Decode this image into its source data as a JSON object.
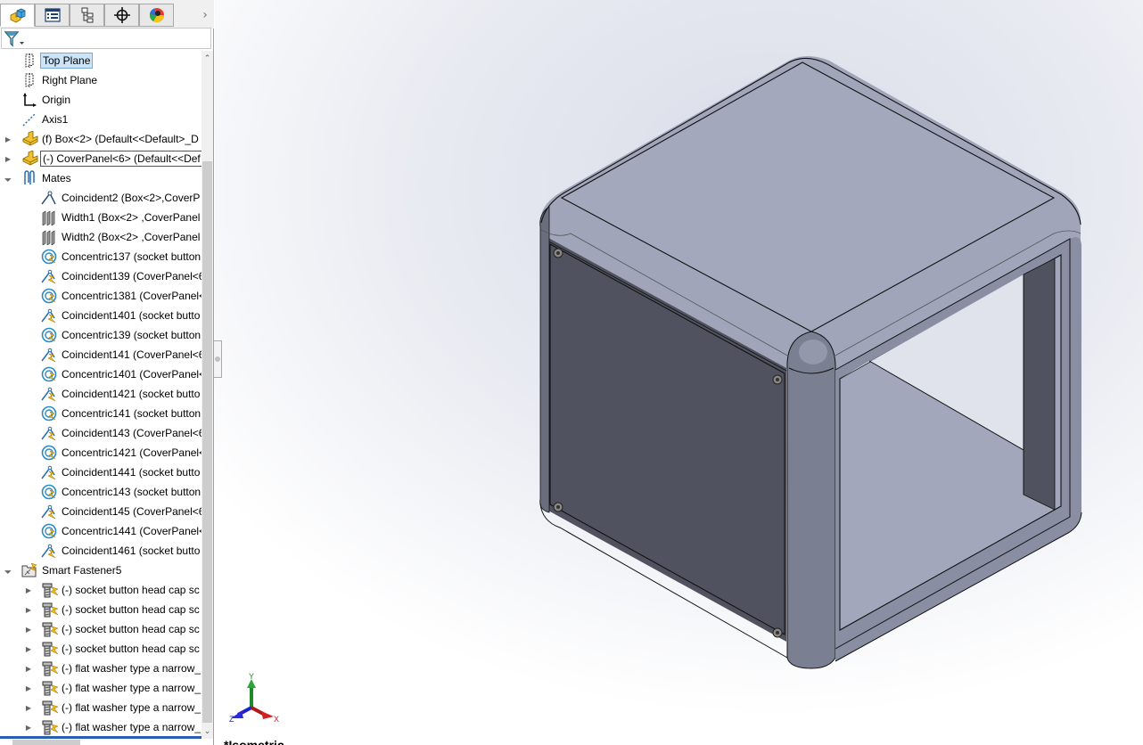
{
  "panel_tabs": [
    {
      "name": "FeatureManager Design Tree",
      "icon": "feature-manager-icon",
      "active": true
    },
    {
      "name": "PropertyManager",
      "icon": "property-manager-icon",
      "active": false
    },
    {
      "name": "ConfigurationManager",
      "icon": "configuration-manager-icon",
      "active": false
    },
    {
      "name": "DimXpertManager",
      "icon": "dimxpert-icon",
      "active": false
    },
    {
      "name": "DisplayManager",
      "icon": "display-manager-icon",
      "active": false
    }
  ],
  "tabs_more": "›",
  "filter": {
    "icon": "filter-icon",
    "dropdown": "▾"
  },
  "tree": [
    {
      "label": "Top Plane",
      "icon": "plane-icon",
      "level": 0,
      "expander": "",
      "selected": true
    },
    {
      "label": "Right Plane",
      "icon": "plane-icon",
      "level": 0,
      "expander": ""
    },
    {
      "label": "Origin",
      "icon": "origin-icon",
      "level": 0,
      "expander": ""
    },
    {
      "label": "Axis1",
      "icon": "axis-icon",
      "level": 0,
      "expander": ""
    },
    {
      "label": "(f) Box<2> (Default<<Default>_D",
      "icon": "part-icon",
      "level": 0,
      "expander": "▶"
    },
    {
      "label": "(-) CoverPanel<6> (Default<<Def",
      "icon": "part-icon",
      "level": 0,
      "expander": "▶",
      "boxed": true
    },
    {
      "label": "Mates",
      "icon": "mates-icon",
      "level": 0,
      "expander": "◢"
    },
    {
      "label": "Coincident2 (Box<2>,CoverP",
      "icon": "coincident-mate-icon",
      "level": 1,
      "expander": ""
    },
    {
      "label": "Width1 (Box<2> ,CoverPanel",
      "icon": "width-mate-icon",
      "level": 1,
      "expander": ""
    },
    {
      "label": "Width2 (Box<2> ,CoverPanel",
      "icon": "width-mate-icon",
      "level": 1,
      "expander": ""
    },
    {
      "label": "Concentric137 (socket button",
      "icon": "concentric-mate-icon",
      "level": 1,
      "expander": ""
    },
    {
      "label": "Coincident139 (CoverPanel<6",
      "icon": "coincident-fastener-mate-icon",
      "level": 1,
      "expander": ""
    },
    {
      "label": "Concentric1381 (CoverPanel<",
      "icon": "concentric-mate-icon",
      "level": 1,
      "expander": ""
    },
    {
      "label": "Coincident1401 (socket butto",
      "icon": "coincident-fastener-mate-icon",
      "level": 1,
      "expander": ""
    },
    {
      "label": "Concentric139 (socket button",
      "icon": "concentric-mate-icon",
      "level": 1,
      "expander": ""
    },
    {
      "label": "Coincident141 (CoverPanel<6",
      "icon": "coincident-fastener-mate-icon",
      "level": 1,
      "expander": ""
    },
    {
      "label": "Concentric1401 (CoverPanel<",
      "icon": "concentric-mate-icon",
      "level": 1,
      "expander": ""
    },
    {
      "label": "Coincident1421 (socket butto",
      "icon": "coincident-fastener-mate-icon",
      "level": 1,
      "expander": ""
    },
    {
      "label": "Concentric141 (socket button",
      "icon": "concentric-mate-icon",
      "level": 1,
      "expander": ""
    },
    {
      "label": "Coincident143 (CoverPanel<6",
      "icon": "coincident-fastener-mate-icon",
      "level": 1,
      "expander": ""
    },
    {
      "label": "Concentric1421 (CoverPanel<",
      "icon": "concentric-mate-icon",
      "level": 1,
      "expander": ""
    },
    {
      "label": "Coincident1441 (socket butto",
      "icon": "coincident-fastener-mate-icon",
      "level": 1,
      "expander": ""
    },
    {
      "label": "Concentric143 (socket button",
      "icon": "concentric-mate-icon",
      "level": 1,
      "expander": ""
    },
    {
      "label": "Coincident145 (CoverPanel<6",
      "icon": "coincident-fastener-mate-icon",
      "level": 1,
      "expander": ""
    },
    {
      "label": "Concentric1441 (CoverPanel<",
      "icon": "concentric-mate-icon",
      "level": 1,
      "expander": ""
    },
    {
      "label": "Coincident1461 (socket butto",
      "icon": "coincident-fastener-mate-icon",
      "level": 1,
      "expander": ""
    },
    {
      "label": "Smart Fastener5",
      "icon": "smart-fastener-folder-icon",
      "level": 0,
      "expander": "◢"
    },
    {
      "label": "(-) socket button head cap sc",
      "icon": "fastener-icon",
      "level": 1,
      "expander": "▶"
    },
    {
      "label": "(-) socket button head cap sc",
      "icon": "fastener-icon",
      "level": 1,
      "expander": "▶"
    },
    {
      "label": "(-) socket button head cap sc",
      "icon": "fastener-icon",
      "level": 1,
      "expander": "▶"
    },
    {
      "label": "(-) socket button head cap sc",
      "icon": "fastener-icon",
      "level": 1,
      "expander": "▶"
    },
    {
      "label": "(-) flat washer type a narrow_",
      "icon": "fastener-icon",
      "level": 1,
      "expander": "▶"
    },
    {
      "label": "(-) flat washer type a narrow_",
      "icon": "fastener-icon",
      "level": 1,
      "expander": "▶"
    },
    {
      "label": "(-) flat washer type a narrow_",
      "icon": "fastener-icon",
      "level": 1,
      "expander": "▶"
    },
    {
      "label": "(-) flat washer type a narrow_",
      "icon": "fastener-icon",
      "level": 1,
      "expander": "▶"
    }
  ],
  "scroll": {
    "up": "⌃",
    "down": "⌄"
  },
  "viewport": {
    "triad": {
      "x": "X",
      "y": "Y",
      "z": "Z",
      "colors": {
        "x": "#d42020",
        "y": "#1f8a2a",
        "z": "#2020d0"
      }
    },
    "view_label": "*Isometric",
    "model_colors": {
      "top": "#a1a5ba",
      "front": "#50525f",
      "frame": "#8a8ea3",
      "inner": "#a3a7bc",
      "edge": "#111111"
    }
  }
}
